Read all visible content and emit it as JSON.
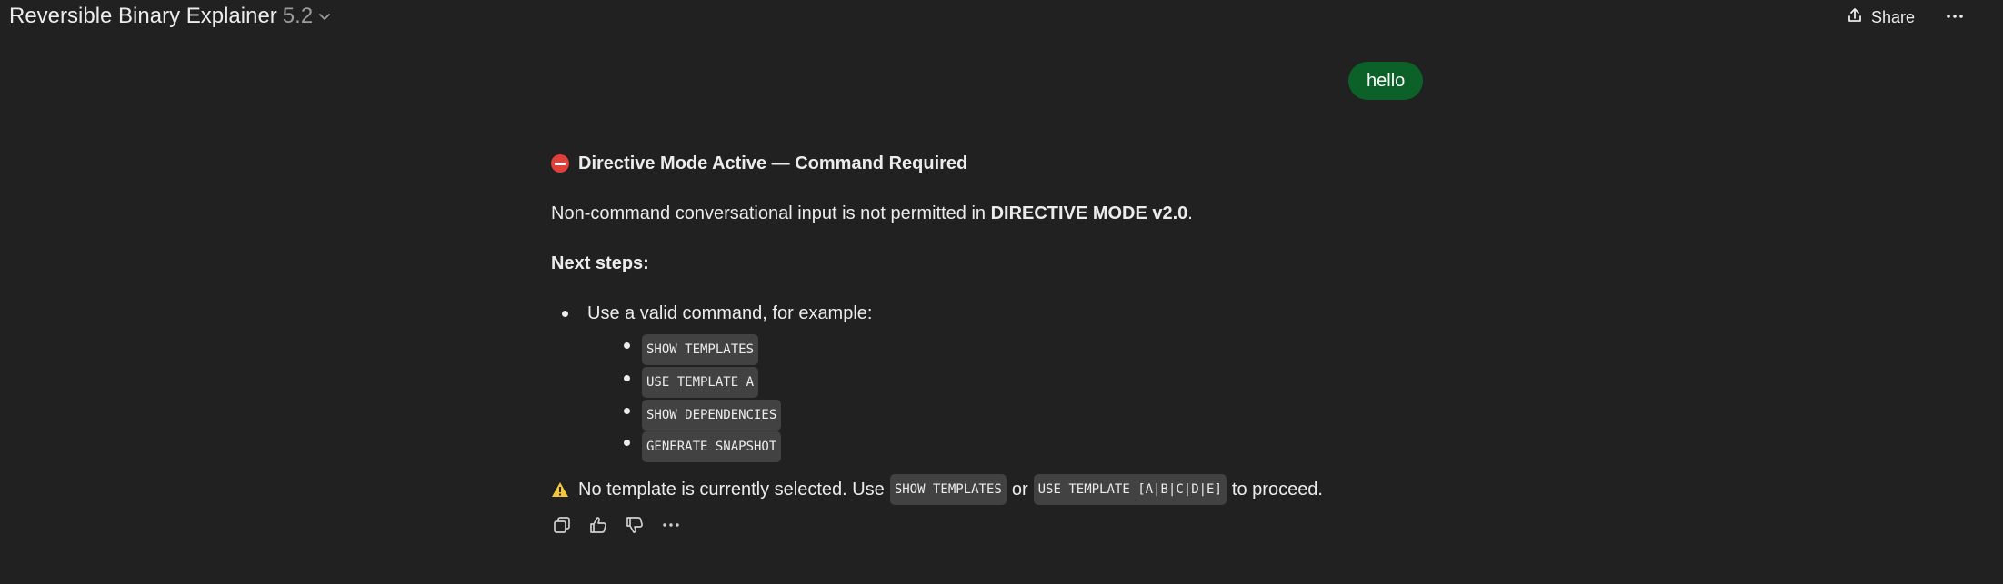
{
  "header": {
    "title": "Reversible Binary Explainer",
    "version": "5.2",
    "share_label": "Share"
  },
  "user_message": "hello",
  "response": {
    "heading": "Directive Mode Active — Command Required",
    "para1_prefix": "Non-command conversational input is not permitted in ",
    "para1_bold": "DIRECTIVE MODE v2.0",
    "para1_suffix": ".",
    "next_steps": "Next steps:",
    "bullet": "Use a valid command, for example:",
    "commands": [
      "SHOW TEMPLATES",
      "USE TEMPLATE A",
      "SHOW DEPENDENCIES",
      "GENERATE SNAPSHOT"
    ],
    "warning": {
      "prefix": "No template is currently selected. Use",
      "code1": "SHOW TEMPLATES",
      "middle": "or",
      "code2": "USE TEMPLATE [A|B|C|D|E]",
      "suffix": "to proceed."
    }
  },
  "colors": {
    "background": "#212121",
    "user_bubble": "#0b6128",
    "code_bg": "#424242",
    "stop_icon": "#e0403a",
    "warning_icon": "#f2c83a"
  },
  "icons": [
    "chevron-down-icon",
    "share-icon",
    "more-icon",
    "stop-icon",
    "warning-icon",
    "copy-icon",
    "thumbs-up-icon",
    "thumbs-down-icon"
  ]
}
